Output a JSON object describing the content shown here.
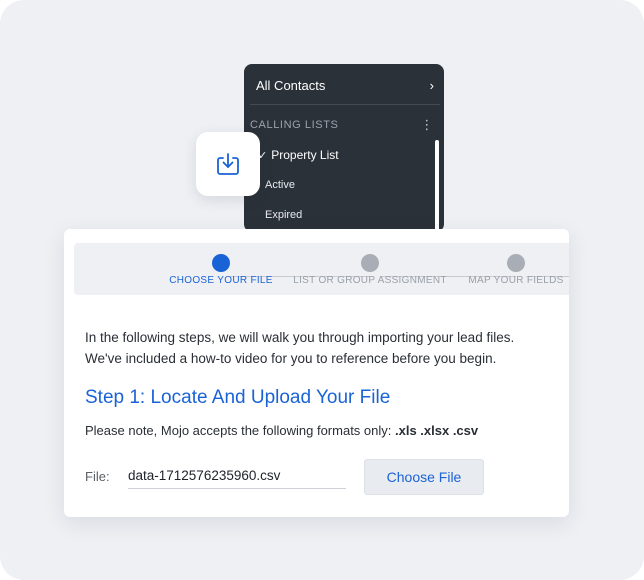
{
  "colors": {
    "accent": "#1a63d6",
    "dropdown_bg": "#2b3139",
    "stepper_bg": "#eef0f4",
    "inactive_dot": "#a9aeb6"
  },
  "dropdown": {
    "all_contacts": "All Contacts",
    "section_title": "CALLING LISTS",
    "items": [
      {
        "label": "Property List",
        "selected": true
      },
      {
        "label": "Active",
        "selected": false
      },
      {
        "label": "Expired",
        "selected": false
      }
    ],
    "chevron_glyph": "›",
    "menu_glyph": "⋮",
    "check_glyph": "✓"
  },
  "icon_card": {
    "icon": "download-tray-icon"
  },
  "stepper": {
    "steps": [
      {
        "label": "CHOOSE YOUR FILE",
        "active": true
      },
      {
        "label": "LIST OR GROUP ASSIGNMENT",
        "active": false
      },
      {
        "label": "MAP YOUR FIELDS",
        "active": false
      }
    ]
  },
  "content": {
    "intro_line1": "In the following steps, we will walk you through importing your lead files.",
    "intro_line2": "We've included a how-to video for you to reference before you begin.",
    "step_title": "Step 1: Locate And Upload Your File",
    "note_prefix": "Please note, Mojo accepts the following formats only: ",
    "note_formats": ".xls .xlsx .csv",
    "file_label": "File:",
    "file_value": "data-1712576235960.csv",
    "choose_label": "Choose File"
  }
}
